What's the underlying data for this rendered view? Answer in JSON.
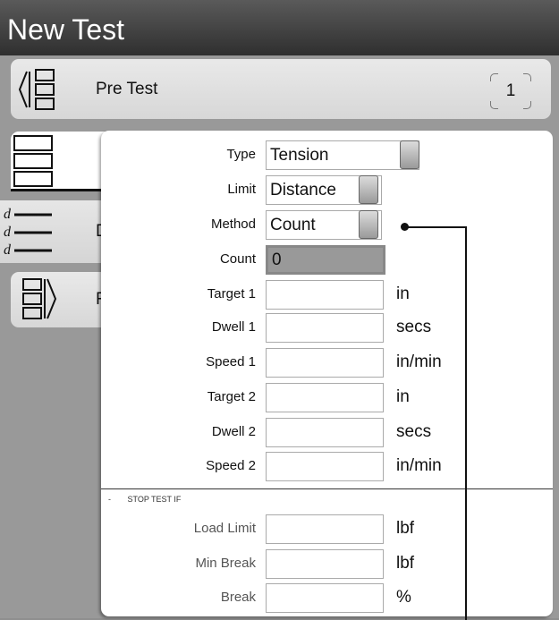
{
  "window": {
    "title": "New Test"
  },
  "steps": {
    "pretest": {
      "label": "Pre Test",
      "count": "1"
    },
    "distance": {
      "label_fragment": "D"
    },
    "post": {
      "label_fragment": "F"
    }
  },
  "form": {
    "type": {
      "label": "Type",
      "value": "Tension"
    },
    "limit": {
      "label": "Limit",
      "value": "Distance"
    },
    "method": {
      "label": "Method",
      "value": "Count"
    },
    "count": {
      "label": "Count",
      "value": "0"
    },
    "target1": {
      "label": "Target 1",
      "unit": "in",
      "value": ""
    },
    "dwell1": {
      "label": "Dwell 1",
      "unit": "secs",
      "value": ""
    },
    "speed1": {
      "label": "Speed 1",
      "unit": "in/min",
      "value": ""
    },
    "target2": {
      "label": "Target 2",
      "unit": "in",
      "value": ""
    },
    "dwell2": {
      "label": "Dwell 2",
      "unit": "secs",
      "value": ""
    },
    "speed2": {
      "label": "Speed 2",
      "unit": "in/min",
      "value": ""
    }
  },
  "stop_section": {
    "collapse_marker": "-",
    "header": "STOP TEST IF",
    "load_limit": {
      "label": "Load Limit",
      "unit": "lbf",
      "value": ""
    },
    "min_break": {
      "label": "Min Break",
      "unit": "lbf",
      "value": ""
    },
    "break": {
      "label": "Break",
      "unit": "%",
      "value": ""
    }
  },
  "icons": {
    "pretest": "pretest-stack-icon",
    "selected": "stack-icon",
    "distance": "distance-list-icon",
    "post": "posttest-stack-icon"
  }
}
